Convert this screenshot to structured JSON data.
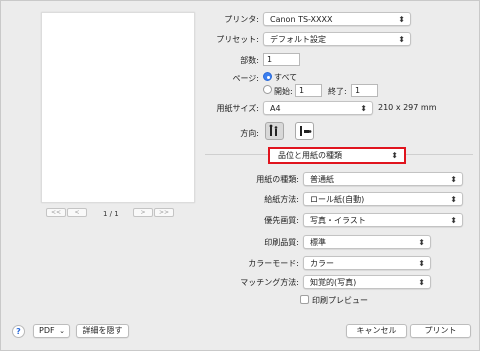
{
  "printer": {
    "label": "プリンタ:",
    "value": "Canon TS-XXXX"
  },
  "preset": {
    "label": "プリセット:",
    "value": "デフォルト設定"
  },
  "copies": {
    "label": "部数:",
    "value": "1"
  },
  "pages": {
    "label": "ページ:",
    "all_label": "すべて",
    "from_label": "開始:",
    "from_value": "1",
    "to_label": "終了:",
    "to_value": "1"
  },
  "paper_size": {
    "label": "用紙サイズ:",
    "value": "A4",
    "dimensions": "210 x 297 mm"
  },
  "orientation": {
    "label": "方向:"
  },
  "panel_selector": {
    "value": "品位と用紙の種類"
  },
  "media_type": {
    "label": "用紙の種類:",
    "value": "普通紙"
  },
  "paper_source": {
    "label": "給紙方法:",
    "value": "ロール紙(自動)"
  },
  "image_priority": {
    "label": "優先画質:",
    "value": "写真・イラスト"
  },
  "print_quality": {
    "label": "印刷品質:",
    "value": "標準"
  },
  "color_mode": {
    "label": "カラーモード:",
    "value": "カラー"
  },
  "matching": {
    "label": "マッチング方法:",
    "value": "知覚的(写真)"
  },
  "print_preview": {
    "label": "印刷プレビュー"
  },
  "preview": {
    "page_indicator": "1 / 1",
    "first": "<<",
    "prev": "<",
    "next": ">",
    "last": ">>"
  },
  "footer": {
    "help": "?",
    "pdf": "PDF",
    "hide_details": "詳細を隠す",
    "cancel": "キャンセル",
    "print": "プリント"
  },
  "icons": {
    "chevron": "updown-chevron-icon",
    "help": "help-icon"
  }
}
